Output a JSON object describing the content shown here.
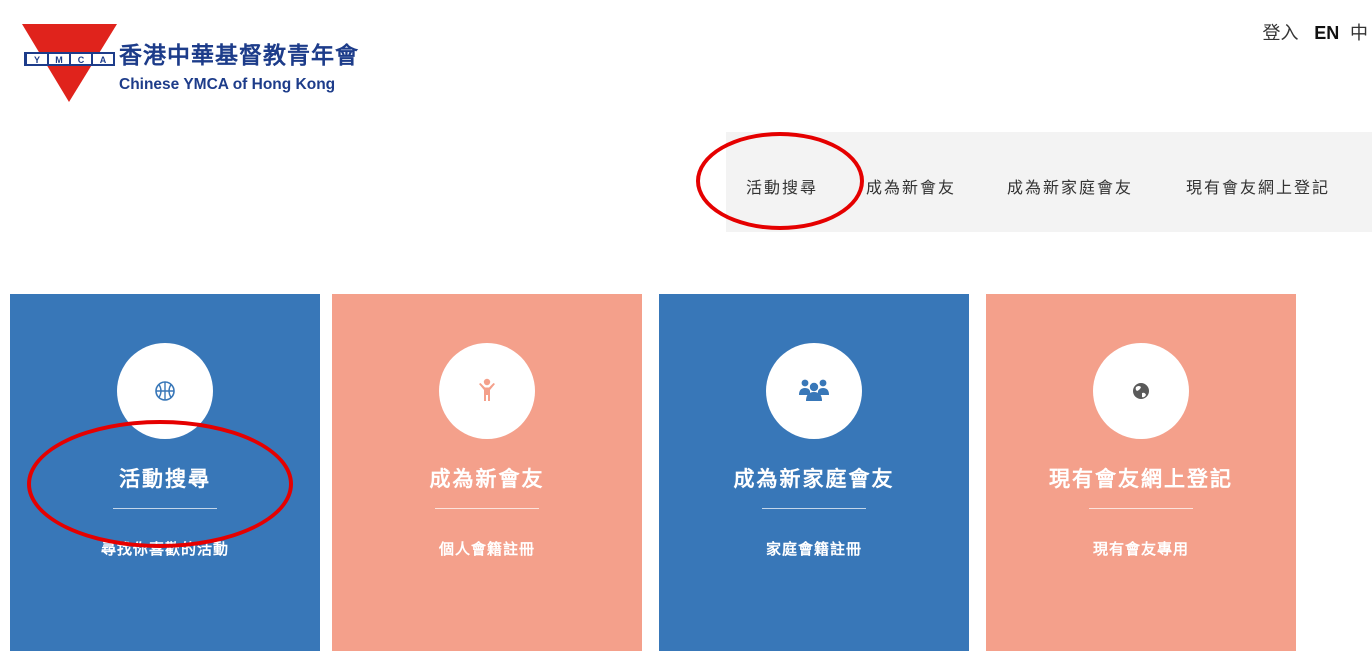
{
  "brand": {
    "name_zh": "香港中華基督教青年會",
    "name_en": "Chinese YMCA of Hong Kong",
    "logo_letters": "YMCA",
    "color_primary": "#1d3c8a",
    "color_red": "#e0231c"
  },
  "top_links": {
    "login": "登入",
    "lang_en": "EN",
    "lang_zh": "中"
  },
  "nav": {
    "items": [
      {
        "label": "活動搜尋"
      },
      {
        "label": "成為新會友"
      },
      {
        "label": "成為新家庭會友"
      },
      {
        "label": "現有會友網上登記"
      }
    ],
    "background": "#f3f3f3"
  },
  "cards": [
    {
      "title": "活動搜尋",
      "subtitle": "尋找你喜歡的活動",
      "icon": "basketball-icon",
      "color": "#3877b8"
    },
    {
      "title": "成為新會友",
      "subtitle": "個人會籍註冊",
      "icon": "child-icon",
      "color": "#f4a08b"
    },
    {
      "title": "成為新家庭會友",
      "subtitle": "家庭會籍註冊",
      "icon": "group-icon",
      "color": "#3877b8"
    },
    {
      "title": "現有會友網上登記",
      "subtitle": "現有會友專用",
      "icon": "globe-icon",
      "color": "#f4a08b"
    }
  ],
  "annotations": {
    "color": "#e50000"
  }
}
